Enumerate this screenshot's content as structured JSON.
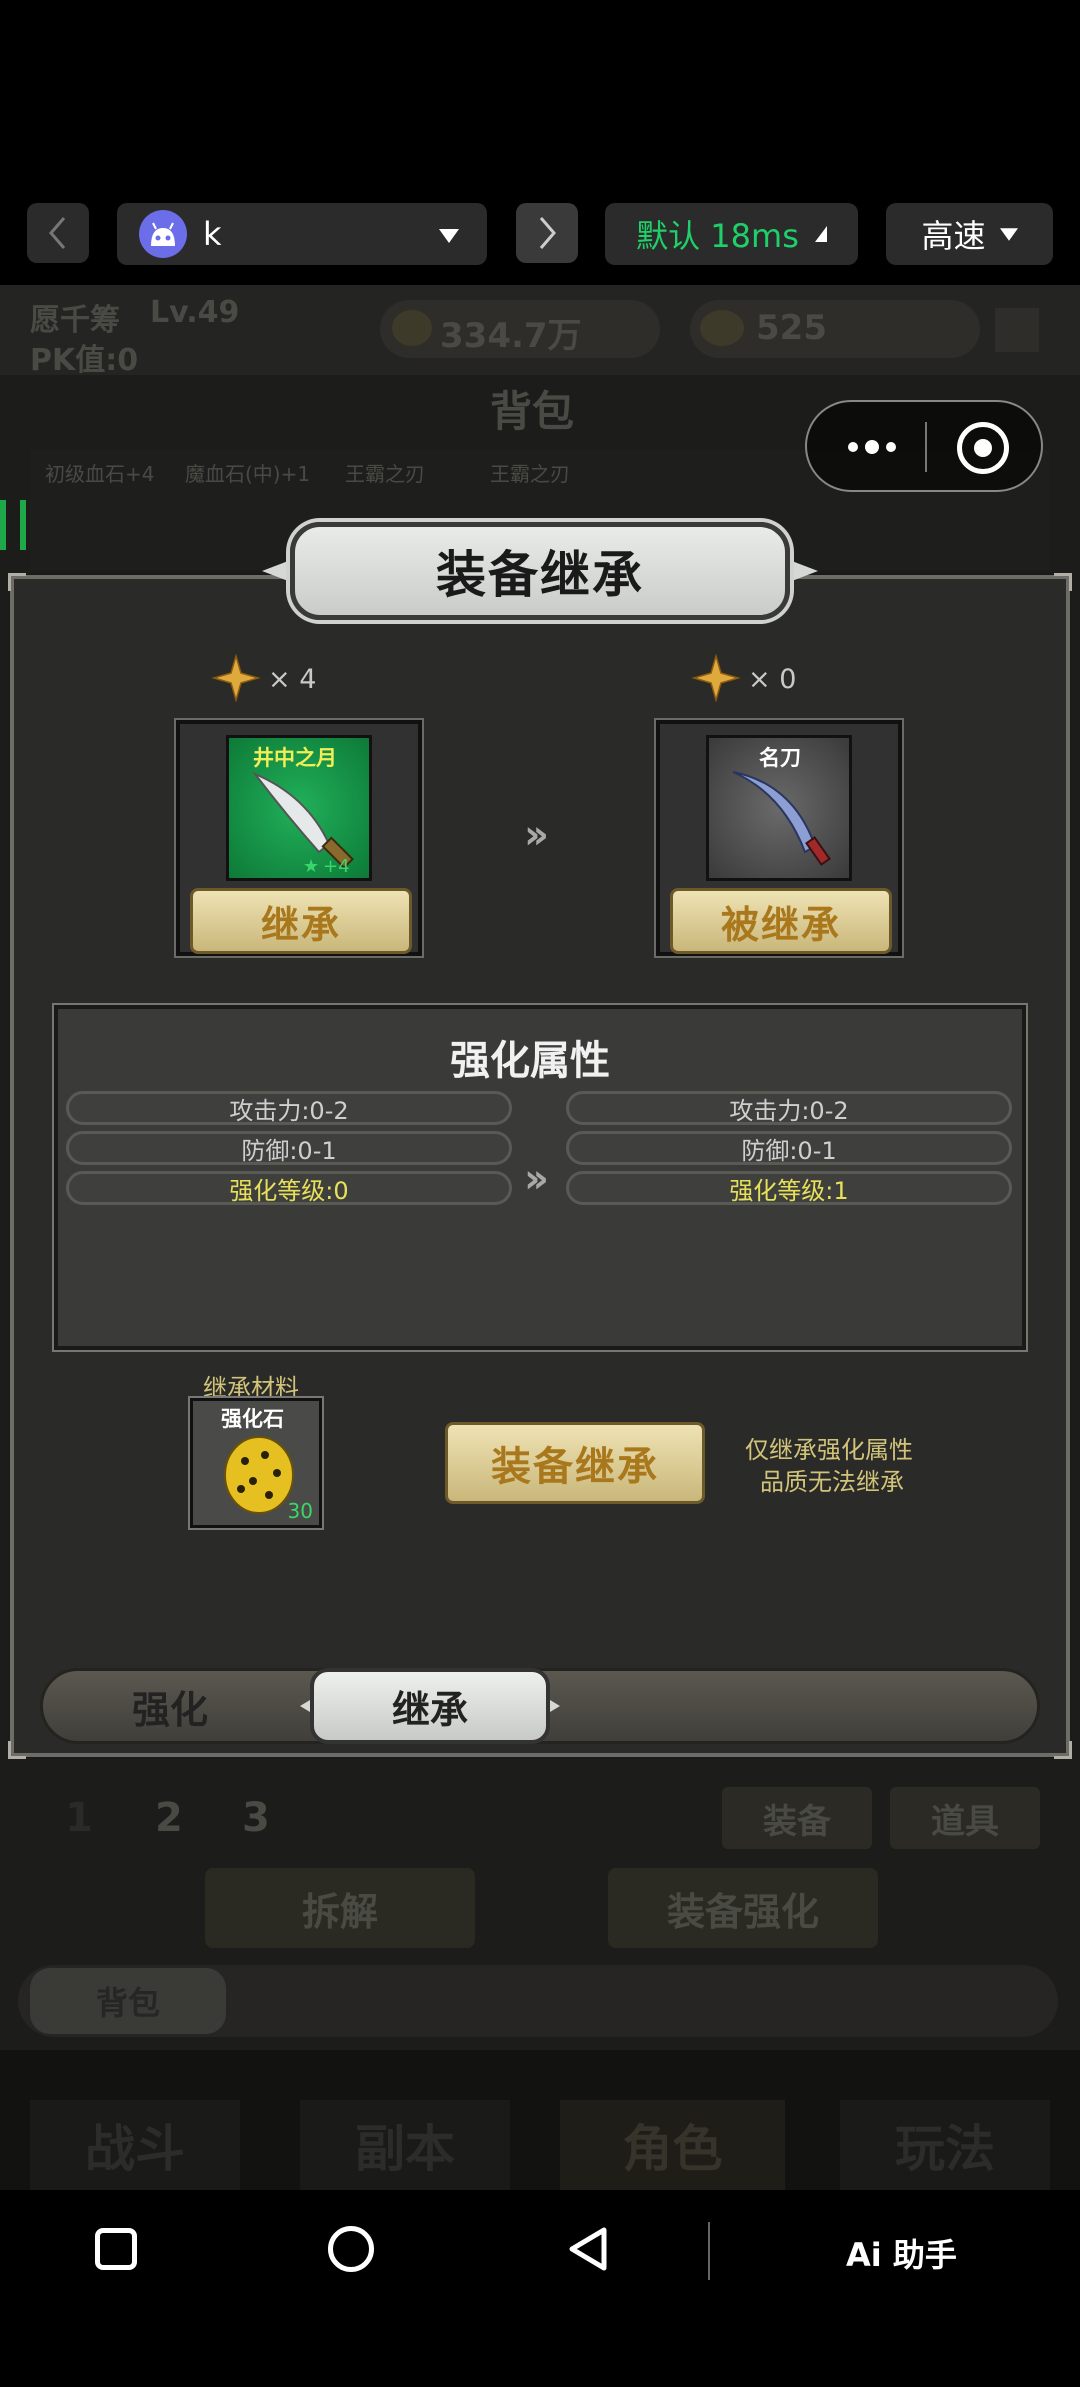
{
  "toolbar": {
    "back_icon": "chevron-left-icon",
    "forward_icon": "chevron-right-icon",
    "account_name": "k",
    "latency": "默认 18ms",
    "speed": "高速"
  },
  "game_bg": {
    "player_name": "愿千筹",
    "player_level": "Lv.49",
    "pk_value": "PK值:0",
    "gold": "334.7万",
    "ingot": "525",
    "bag_title": "背包",
    "items": [
      "初级血石+4",
      "魔血石(中)+1",
      "王霸之刃",
      "王霸之刃"
    ],
    "pages": [
      "1",
      "2",
      "3"
    ],
    "tabs": [
      "装备",
      "道具"
    ],
    "action_buttons": [
      "拆解",
      "装备强化"
    ],
    "sub_tab": "背包",
    "bottom_nav": [
      "战斗",
      "副本",
      "角色",
      "玩法"
    ]
  },
  "dialog": {
    "title": "装备继承",
    "source": {
      "star_count": "× 4",
      "item_name": "井中之月",
      "item_level": "+4",
      "button": "继承"
    },
    "target": {
      "star_count": "× 0",
      "item_name": "名刀",
      "button": "被继承"
    },
    "attributes": {
      "title": "强化属性",
      "left": [
        "攻击力:0-2",
        "防御:0-1",
        "强化等级:0"
      ],
      "right": [
        "攻击力:0-2",
        "防御:0-1",
        "强化等级:1"
      ]
    },
    "material": {
      "label": "继承材料",
      "name": "强化石",
      "count": "30"
    },
    "inherit_button": "装备继承",
    "note_line1": "仅继承强化属性",
    "note_line2": "品质无法继承",
    "tabs": [
      "强化",
      "继承"
    ],
    "active_tab": "继承"
  },
  "system_nav": {
    "assistant": "Ai 助手"
  },
  "colors": {
    "latency_green": "#1fd06a",
    "gold_text": "#a9781d",
    "highlight_yellow": "#e7e05a"
  }
}
